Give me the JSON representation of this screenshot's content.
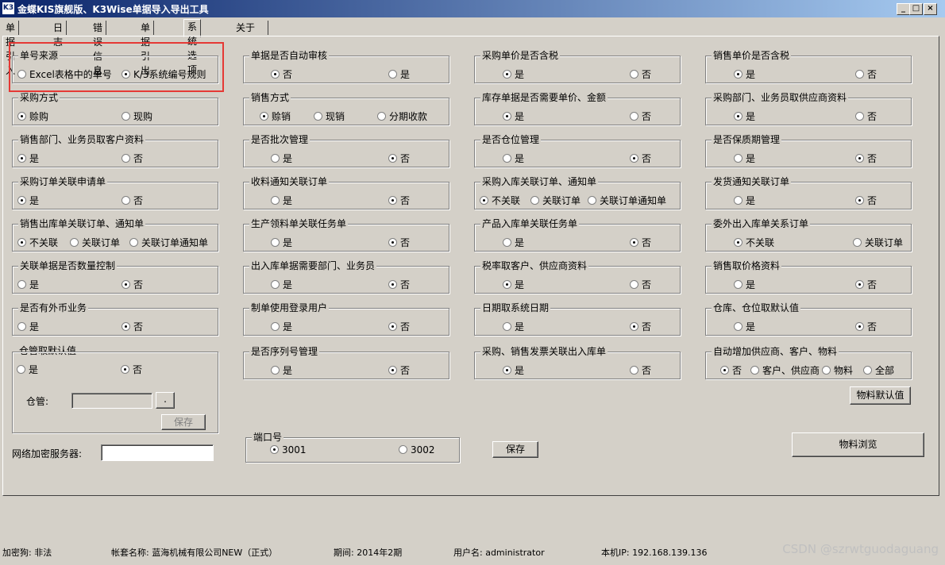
{
  "window": {
    "title": "金蝶KIS旗舰版、K3Wise单据导入导出工具",
    "icon": "K3"
  },
  "tabs": [
    "单据引入",
    "日志",
    "错误信息",
    "单据引出",
    "系统选项",
    "关于"
  ],
  "active_tab": "系统选项",
  "groups": [
    {
      "label": "单号来源",
      "options": [
        "Excel表格中的单号",
        "K/3系统编号规则"
      ],
      "selected": 1
    },
    {
      "label": "单据是否自动审核",
      "options": [
        "否",
        "是"
      ],
      "selected": 0
    },
    {
      "label": "采购单价是否含税",
      "options": [
        "是",
        "否"
      ],
      "selected": 0
    },
    {
      "label": "销售单价是否含税",
      "options": [
        "是",
        "否"
      ],
      "selected": 0
    },
    {
      "label": "采购方式",
      "options": [
        "赊购",
        "现购"
      ],
      "selected": 0
    },
    {
      "label": "销售方式",
      "options": [
        "赊销",
        "现销",
        "分期收款"
      ],
      "selected": 0
    },
    {
      "label": "库存单据是否需要单价、金额",
      "options": [
        "是",
        "否"
      ],
      "selected": 0
    },
    {
      "label": "采购部门、业务员取供应商资料",
      "options": [
        "是",
        "否"
      ],
      "selected": 0
    },
    {
      "label": "销售部门、业务员取客户资料",
      "options": [
        "是",
        "否"
      ],
      "selected": 0
    },
    {
      "label": "是否批次管理",
      "options": [
        "是",
        "否"
      ],
      "selected": 1
    },
    {
      "label": "是否仓位管理",
      "options": [
        "是",
        "否"
      ],
      "selected": 1
    },
    {
      "label": "是否保质期管理",
      "options": [
        "是",
        "否"
      ],
      "selected": 1
    },
    {
      "label": "采购订单关联申请单",
      "options": [
        "是",
        "否"
      ],
      "selected": 0
    },
    {
      "label": "收料通知关联订单",
      "options": [
        "是",
        "否"
      ],
      "selected": 1
    },
    {
      "label": "采购入库关联订单、通知单",
      "options": [
        "不关联",
        "关联订单",
        "关联订单通知单"
      ],
      "selected": 0
    },
    {
      "label": "发货通知关联订单",
      "options": [
        "是",
        "否"
      ],
      "selected": 1
    },
    {
      "label": "销售出库单关联订单、通知单",
      "options": [
        "不关联",
        "关联订单",
        "关联订单通知单"
      ],
      "selected": 0
    },
    {
      "label": "生产领料单关联任务单",
      "options": [
        "是",
        "否"
      ],
      "selected": 1
    },
    {
      "label": "产品入库单关联任务单",
      "options": [
        "是",
        "否"
      ],
      "selected": 1
    },
    {
      "label": "委外出入库单关系订单",
      "options": [
        "不关联",
        "关联订单"
      ],
      "selected": 0
    },
    {
      "label": "关联单据是否数量控制",
      "options": [
        "是",
        "否"
      ],
      "selected": 1
    },
    {
      "label": "出入库单据需要部门、业务员",
      "options": [
        "是",
        "否"
      ],
      "selected": 1
    },
    {
      "label": "税率取客户、供应商资料",
      "options": [
        "是",
        "否"
      ],
      "selected": 0
    },
    {
      "label": "销售取价格资料",
      "options": [
        "是",
        "否"
      ],
      "selected": 1
    },
    {
      "label": "是否有外币业务",
      "options": [
        "是",
        "否"
      ],
      "selected": 1
    },
    {
      "label": "制单使用登录用户",
      "options": [
        "是",
        "否"
      ],
      "selected": 1
    },
    {
      "label": "日期取系统日期",
      "options": [
        "是",
        "否"
      ],
      "selected": 1
    },
    {
      "label": "仓库、仓位取默认值",
      "options": [
        "是",
        "否"
      ],
      "selected": 1
    },
    {
      "label": "仓管取默认值",
      "options": [
        "是",
        "否"
      ],
      "selected": 1
    },
    {
      "label": "是否序列号管理",
      "options": [
        "是",
        "否"
      ],
      "selected": 1
    },
    {
      "label": "采购、销售发票关联出入库单",
      "options": [
        "是",
        "否"
      ],
      "selected": 0
    },
    {
      "label": "自动增加供应商、客户、物料",
      "options": [
        "否",
        "客户、供应商",
        "物料",
        "全部"
      ],
      "selected": 0
    }
  ],
  "warehouse": {
    "label": "仓管:",
    "browse": ".",
    "save": "保存"
  },
  "port": {
    "label": "端口号",
    "options": [
      "3001",
      "3002"
    ],
    "selected": 0
  },
  "network_server": {
    "label": "网络加密服务器:",
    "value": ""
  },
  "buttons": {
    "save": "保存",
    "material_default": "物料默认值",
    "material_browse": "物料浏览"
  },
  "status": {
    "encrypt": "加密狗: 非法",
    "account": "帐套名称: 蓝海机械有限公司NEW（正式）",
    "period": "期间: 2014年2期",
    "user": "用户名: administrator",
    "ip": "本机IP: 192.168.139.136"
  },
  "watermark": "CSDN @szrwtguodaguang"
}
